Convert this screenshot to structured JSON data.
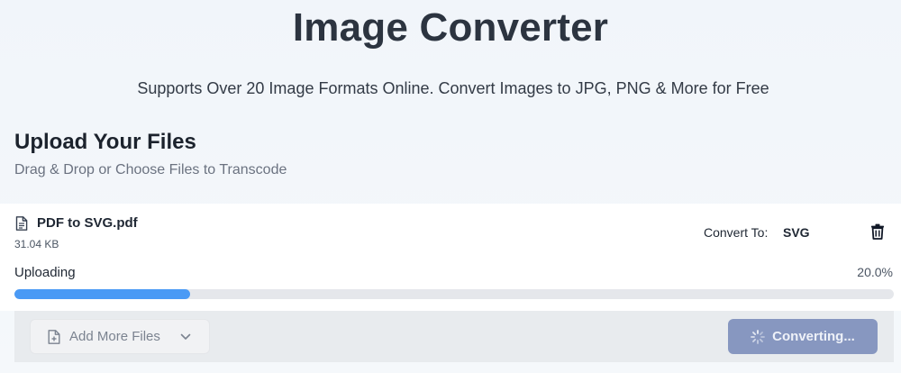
{
  "header": {
    "title": "Image Converter",
    "subtitle": "Supports Over 20 Image Formats Online. Convert Images to JPG, PNG & More for Free"
  },
  "upload": {
    "title": "Upload Your Files",
    "subtitle": "Drag & Drop or Choose Files to Transcode"
  },
  "file": {
    "name": "PDF to SVG.pdf",
    "size": "31.04 KB",
    "convert_label": "Convert To:",
    "convert_value": "SVG",
    "status": "Uploading",
    "progress_text": "20.0%",
    "progress_value": 0.2
  },
  "actions": {
    "add_more_label": "Add More Files",
    "convert_label": "Converting..."
  },
  "colors": {
    "accent": "#4a9af5",
    "button_disabled": "#8797c0"
  },
  "icons": {
    "file": "document-icon",
    "delete": "trash-icon",
    "add": "file-plus-icon",
    "dropdown": "chevron-down-icon",
    "loading": "spinner-icon"
  }
}
